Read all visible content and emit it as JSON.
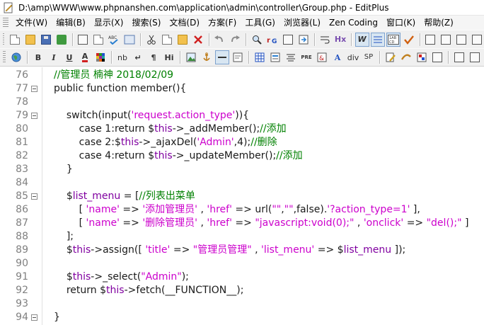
{
  "window": {
    "title": "D:\\amp\\WWW\\www.phpnanshen.com\\application\\admin\\controller\\Group.php - EditPlus"
  },
  "menu": [
    "文件(W)",
    "编辑(B)",
    "显示(X)",
    "搜索(S)",
    "文档(D)",
    "方案(F)",
    "工具(G)",
    "浏览器(L)",
    "Zen Coding",
    "窗口(K)",
    "帮助(Z)"
  ],
  "toolbar2": {
    "bold": "B",
    "italic": "I",
    "underline": "U",
    "font_color": "A",
    "nbsp": "nb",
    "line_break": "↵",
    "paragraph": "¶",
    "heading": "Hi",
    "div": "div",
    "span": "SP",
    "pre": "PRE",
    "hx": "Hx"
  },
  "editor": {
    "lines": [
      {
        "n": "76",
        "fold": false,
        "text": "//管理员 楠神 2018/02/09"
      },
      {
        "n": "77",
        "fold": true,
        "text": "public function member(){"
      },
      {
        "n": "78",
        "fold": false,
        "text": ""
      },
      {
        "n": "79",
        "fold": true,
        "text": "    switch(input('request.action_type')){"
      },
      {
        "n": "80",
        "fold": false,
        "text": "        case 1:return $this->_addMember();//添加"
      },
      {
        "n": "81",
        "fold": false,
        "text": "        case 2:$this->_ajaxDel('Admin',4);//删除"
      },
      {
        "n": "82",
        "fold": false,
        "text": "        case 4:return $this->_updateMember();//添加"
      },
      {
        "n": "83",
        "fold": false,
        "text": "    }"
      },
      {
        "n": "84",
        "fold": false,
        "text": ""
      },
      {
        "n": "85",
        "fold": true,
        "text": "    $list_menu = [//列表出菜单"
      },
      {
        "n": "86",
        "fold": false,
        "text": "        [ 'name' => '添加管理员' , 'href' => url(\"\",\"\",false).'?action_type=1' ],"
      },
      {
        "n": "87",
        "fold": false,
        "text": "        [ 'name' => '删除管理员' , 'href' => \"javascript:void(0);\" , 'onclick' => \"del();\" ]"
      },
      {
        "n": "88",
        "fold": false,
        "text": "    ];"
      },
      {
        "n": "89",
        "fold": false,
        "text": "    $this->assign([ 'title' => \"管理员管理\" , 'list_menu' => $list_menu ]);"
      },
      {
        "n": "90",
        "fold": false,
        "text": ""
      },
      {
        "n": "91",
        "fold": false,
        "text": "    $this->_select(\"Admin\");"
      },
      {
        "n": "92",
        "fold": false,
        "text": "    return $this->fetch(__FUNCTION__);"
      },
      {
        "n": "93",
        "fold": false,
        "text": ""
      },
      {
        "n": "94",
        "fold": true,
        "text": "}"
      }
    ]
  },
  "colors": {
    "comment": "#008000",
    "string": "#cc00cc",
    "keyword": "#0000cc",
    "variable": "#8000a0"
  }
}
